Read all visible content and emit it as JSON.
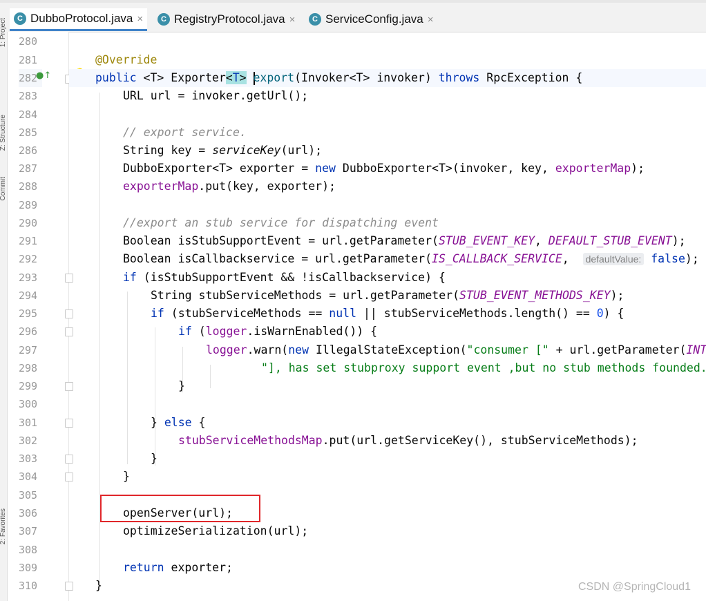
{
  "tabs": [
    {
      "label": "DubboProtocol.java",
      "active": true,
      "icon": "java-class-icon",
      "icon_glyph": "C"
    },
    {
      "label": "RegistryProtocol.java",
      "active": false,
      "icon": "java-class-icon",
      "icon_glyph": "C"
    },
    {
      "label": "ServiceConfig.java",
      "active": false,
      "icon": "java-class-icon",
      "icon_glyph": "C"
    }
  ],
  "close_glyph": "×",
  "side_panels": {
    "project": "1: Project",
    "structure": "Z: Structure",
    "commit": "Commit",
    "favorites": "2: Favorites"
  },
  "gutter_icons": {
    "override_marker": "●↑",
    "intention_bulb": "💡"
  },
  "line_numbers": [
    "280",
    "281",
    "282",
    "283",
    "284",
    "285",
    "286",
    "287",
    "288",
    "289",
    "290",
    "291",
    "292",
    "293",
    "294",
    "295",
    "296",
    "297",
    "298",
    "299",
    "300",
    "301",
    "302",
    "303",
    "304",
    "305",
    "306",
    "307",
    "308",
    "309",
    "310"
  ],
  "current_line": "282",
  "code": {
    "l281": "@Override",
    "l282_kw": "public",
    "l282_a": " <T> Exporter",
    "l282_lt": "<",
    "l282_t": "T",
    "l282_gt": ">",
    "l282_sp": " ",
    "l282_method": "export",
    "l282_b": "(Invoker<T> invoker) ",
    "l282_throws": "throws",
    "l282_c": " RpcException {",
    "l283": "URL url = invoker.getUrl();",
    "l285": "// export service.",
    "l286_a": "String key = ",
    "l286_b": "serviceKey",
    "l286_c": "(url);",
    "l287_a": "DubboExporter<T> exporter = ",
    "l287_new": "new",
    "l287_b": " DubboExporter<T>(invoker, key, ",
    "l287_field": "exporterMap",
    "l287_c": ");",
    "l288_field": "exporterMap",
    "l288_b": ".put(key, exporter);",
    "l290": "//export an stub service for dispatching event",
    "l291_a": "Boolean isStubSupportEvent = url.getParameter(",
    "l291_c1": "STUB_EVENT_KEY",
    "l291_b": ", ",
    "l291_c2": "DEFAULT_STUB_EVENT",
    "l291_c": ");",
    "l292_a": "Boolean isCallbackservice = url.getParameter(",
    "l292_c1": "IS_CALLBACK_SERVICE",
    "l292_b": ",  ",
    "l292_hint": "defaultValue:",
    "l292_false": "false",
    "l292_c": ");",
    "l293_if": "if",
    "l293_b": " (isStubSupportEvent && !isCallbackservice) {",
    "l294_a": "String stubServiceMethods = url.getParameter(",
    "l294_c1": "STUB_EVENT_METHODS_KEY",
    "l294_c": ");",
    "l295_if": "if",
    "l295_a": " (stubServiceMethods == ",
    "l295_null": "null",
    "l295_b": " || stubServiceMethods.length() == ",
    "l295_zero": "0",
    "l295_c": ") {",
    "l296_if": "if",
    "l296_a": " (",
    "l296_logger": "logger",
    "l296_b": ".isWarnEnabled()) {",
    "l297_logger": "logger",
    "l297_a": ".warn(",
    "l297_new": "new",
    "l297_b": " IllegalStateException(",
    "l297_str": "\"consumer [\"",
    "l297_c": " + url.getParameter(",
    "l297_const": "INTERFACE_KEY",
    "l298_str": "\"], has set stubproxy support event ,but no stub methods founded.\"",
    "l299": "}",
    "l301_a": "} ",
    "l301_else": "else",
    "l301_b": " {",
    "l302_field": "stubServiceMethodsMap",
    "l302_b": ".put(url.getServiceKey(), stubServiceMethods);",
    "l303": "}",
    "l304": "}",
    "l306": "openServer(url);",
    "l307": "optimizeSerialization(url);",
    "l309_return": "return",
    "l309_b": " exporter;",
    "l310": "}"
  },
  "watermark": "CSDN @SpringCloud1",
  "colors": {
    "keyword": "#0033b3",
    "annotation": "#9e880d",
    "field": "#871094",
    "comment": "#8c8c8c",
    "string": "#067d17",
    "highlight_box": "#e0262a"
  }
}
